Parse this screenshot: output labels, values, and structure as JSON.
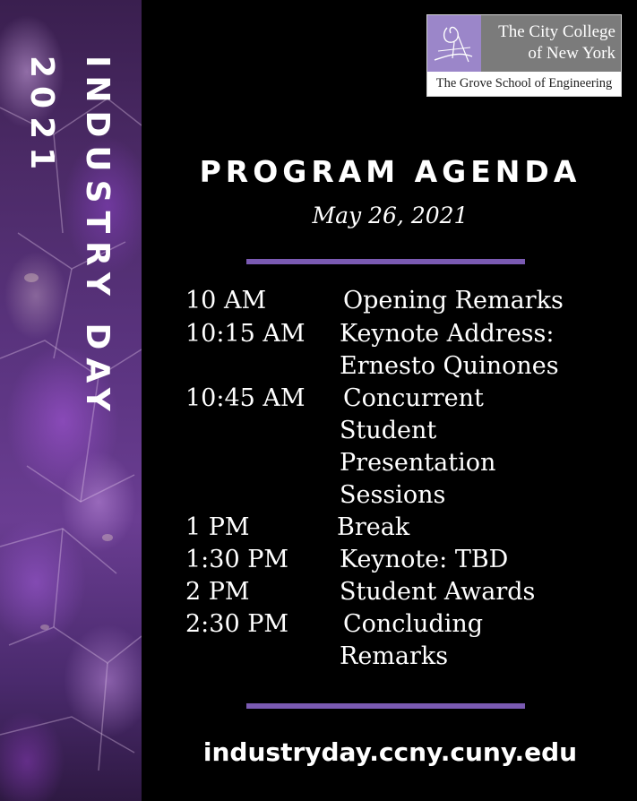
{
  "side_banner": {
    "title": "INDUSTRY DAY",
    "year": "2021"
  },
  "logo": {
    "name_line1": "The City College",
    "name_line2": "of New York",
    "school": "The Grove School of Engineering"
  },
  "heading": "PROGRAM AGENDA",
  "date": "May 26, 2021",
  "agenda": [
    {
      "time": "10 AM",
      "lines": [
        "Opening Remarks"
      ]
    },
    {
      "time": "10:15 AM",
      "lines": [
        "Keynote Address:",
        "Ernesto Quinones"
      ]
    },
    {
      "time": "10:45 AM",
      "lines": [
        "Concurrent",
        "Student",
        "Presentation",
        "Sessions"
      ]
    },
    {
      "time": "1 PM",
      "lines": [
        "Break"
      ]
    },
    {
      "time": "1:30 PM",
      "lines": [
        "Keynote: TBD"
      ]
    },
    {
      "time": "2 PM",
      "lines": [
        "Student Awards"
      ]
    },
    {
      "time": "2:30 PM",
      "lines": [
        "Concluding",
        "Remarks"
      ]
    }
  ],
  "website": "industryday.ccny.cuny.edu",
  "colors": {
    "background": "#000000",
    "accent_rule": "#7a5ab2",
    "logo_mark": "#9b86c9",
    "logo_band": "#7b7b7b"
  }
}
